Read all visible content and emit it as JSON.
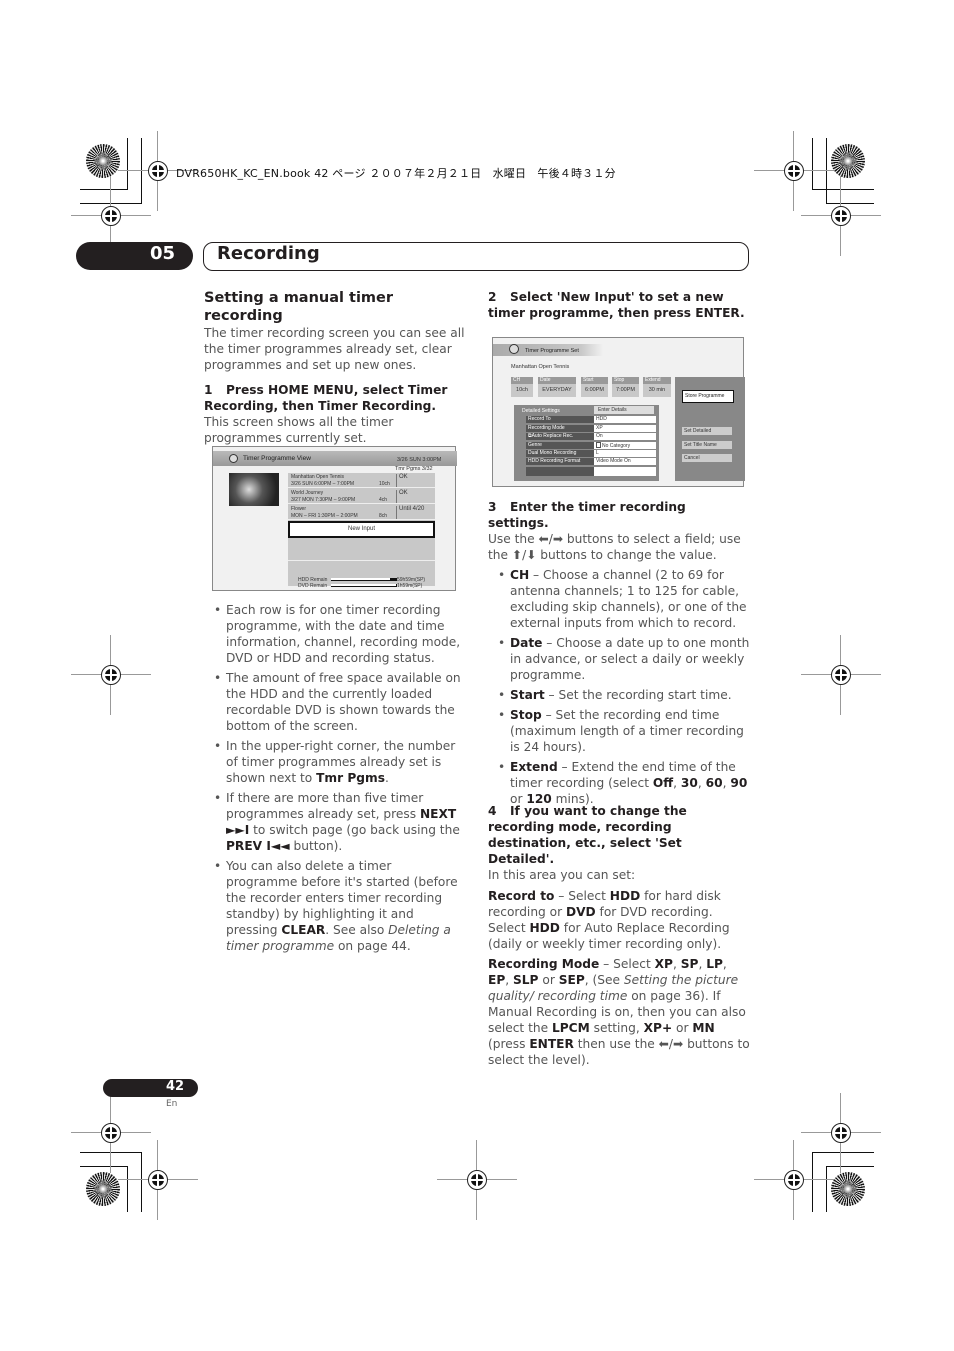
{
  "print_meta": {
    "file_line": "DVR650HK_KC_EN.book  42 ページ  ２００７年２月２１日　水曜日　午後４時３１分"
  },
  "chapter": {
    "number": "05",
    "title": "Recording"
  },
  "left_column": {
    "heading": "Setting a manual timer recording",
    "intro": "The timer recording screen you can see all the timer programmes already set, clear programmes and set up new ones.",
    "step1": {
      "num": "1",
      "title": "Press HOME MENU, select Timer Recording, then Timer Recording.",
      "body": "This screen shows all the timer programmes currently set."
    },
    "bullets": [
      {
        "text": "Each row is for one timer recording programme, with the date and time information, channel, recording mode, DVD or HDD and recording status."
      },
      {
        "text": "The amount of free space available on the HDD and the currently loaded recordable DVD is shown towards the bottom of the screen."
      },
      {
        "pre": "In the upper-right corner, the number of timer programmes already set is shown next to ",
        "bold": "Tmr Pgms",
        "post": "."
      },
      {
        "pre": "If there are more than five timer programmes already set, press ",
        "bold1": "NEXT ►►I",
        "mid": " to switch page (go back using the ",
        "bold2": "PREV I◄◄",
        "post": " button)."
      },
      {
        "pre": "You can also delete a timer programme before it's started (before the recorder enters timer recording standby) by highlighting it and pressing ",
        "bold": "CLEAR",
        "mid": ". See also ",
        "italic": "Deleting a timer programme",
        "post": " on page 44."
      }
    ]
  },
  "screen1": {
    "title": "Timer Programme View",
    "datetime": "3/26 SUN 3:00PM",
    "tmr_pgms": "Tmr Pgms  3/32",
    "rows": [
      {
        "name": "Manhattan Open Tennis",
        "when": "3/26 SUN    6:00PM – 7:00PM",
        "channel": "10ch",
        "status": "OK"
      },
      {
        "name": "World Journey",
        "when": "3/27 MON    7:30PM – 9:00PM",
        "channel": "4ch",
        "status": "OK"
      },
      {
        "name": "Flower",
        "when": "MON – FRI  1:30PM – 2:00PM",
        "channel": "8ch",
        "status": "Until 4/20"
      }
    ],
    "new_input": "New Input",
    "hdd_label": "HDD Remain",
    "hdd_value": "59h59m(SP)",
    "hdd_fill": 0.1,
    "dvd_label": "DVD Remain",
    "dvd_value": "1h59m(SP)",
    "dvd_fill": 0.0
  },
  "right_column": {
    "step2": {
      "num": "2",
      "title": "Select 'New Input' to set a new timer programme, then press ENTER."
    },
    "step3": {
      "num": "3",
      "title": "Enter the timer recording settings.",
      "body": "Use the ⬅/➡ buttons to select a field; use the ⬆/⬇ buttons to change the value.",
      "bullets": [
        {
          "bold": "CH",
          "text": " – Choose a channel (2 to 69 for antenna channels; 1 to 125 for cable, excluding skip channels), or one of the external inputs from which to record."
        },
        {
          "bold": "Date",
          "text": " – Choose a date up to one month in advance, or select a daily or weekly programme."
        },
        {
          "bold": "Start",
          "text": " – Set the recording start time."
        },
        {
          "bold": "Stop",
          "text": " – Set the recording end time (maximum length of a timer recording is 24 hours)."
        },
        {
          "bold": "Extend",
          "text": " – Extend the end time of the timer recording (select ",
          "o1": "Off",
          "o2": "30",
          "o3": "60",
          "o4": "90",
          "or": " or ",
          "o5": "120",
          "post": " mins)."
        }
      ]
    },
    "step4": {
      "num": "4",
      "title": "If you want to change the recording mode, recording destination, etc., select 'Set Detailed'.",
      "body": "In this area you can set:"
    },
    "record_to": {
      "label": "Record to",
      "t1": " – Select ",
      "b1": "HDD",
      "t2": " for hard disk recording or ",
      "b2": "DVD",
      "t3": " for DVD recording. Select ",
      "b3": "HDD",
      "t4": "  for Auto Replace Recording (daily or weekly timer recording only)."
    },
    "recording_mode": {
      "label": "Recording Mode",
      "t1": " – Select ",
      "m1": "XP",
      "m2": "SP",
      "m3": "LP",
      "m4": "EP",
      "m5": "SLP",
      "or1": " or ",
      "m6": "SEP",
      "t2": ", (See ",
      "italic": "Setting the picture quality/ recording time",
      "t3": " on page 36). If Manual Recording is on, then you can also select the ",
      "b1": "LPCM",
      "t4": " setting, ",
      "b2": "XP+",
      "t5": " or ",
      "b3": "MN",
      "t6": " (press ",
      "b4": "ENTER",
      "t7": " then use the ⬅/➡ buttons to select the level)."
    }
  },
  "screen2": {
    "title": "Timer Programme Set",
    "programme": "Manhattan Open Tennis",
    "fields": [
      {
        "label": "CH",
        "value": "10ch"
      },
      {
        "label": "Date",
        "value": "EVERYDAY"
      },
      {
        "label": "Start",
        "value": "6:00PM"
      },
      {
        "label": "Stop",
        "value": "7:00PM"
      },
      {
        "label": "Extend",
        "value": "30 min"
      }
    ],
    "store_button": "Store Programme",
    "side_buttons": [
      "Set Detailed",
      "Set Title Name",
      "Cancel"
    ],
    "detailed_label": "Detailed Settings",
    "enter_details": "Enter Details",
    "details": [
      {
        "label": "Record To",
        "value": "HDD"
      },
      {
        "label": "Recording Mode",
        "value": "XP"
      },
      {
        "label": "Auto Replace Rec.",
        "value": "On"
      },
      {
        "label": "Genre",
        "value": "No Category"
      },
      {
        "label": "Dual Mono Recording",
        "value": "L"
      },
      {
        "label": "HDD Recording Format",
        "value": "Video Mode On"
      }
    ]
  },
  "footer": {
    "page_number": "42",
    "language": "En"
  }
}
